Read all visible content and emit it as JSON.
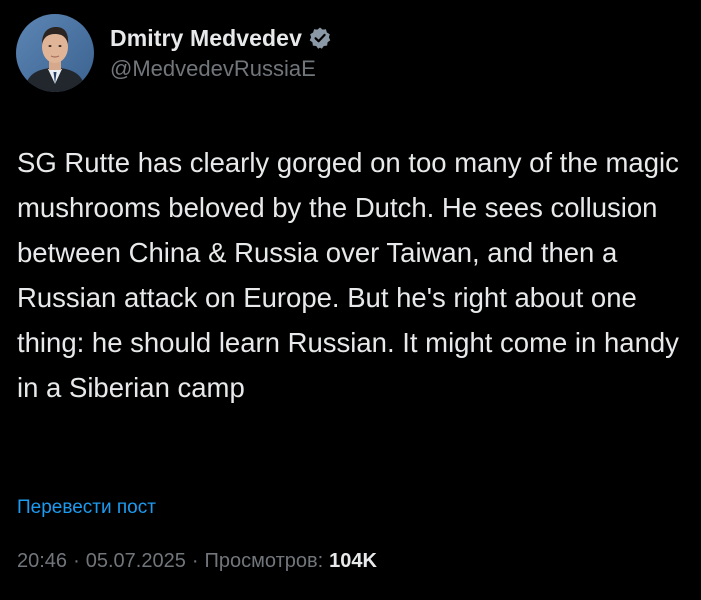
{
  "author": {
    "name": "Dmitry Medvedev",
    "handle": "@MedvedevRussiaE",
    "avatar_icon": "user-avatar",
    "verified_icon": "verified-badge-icon",
    "verified_color": "#8b98a5"
  },
  "post": {
    "text": "SG Rutte has clearly gorged on too many of the magic mushrooms beloved by the Dutch. He sees collusion between China & Russia over Taiwan, and then a Russian attack on Europe. But he's right about one thing: he should learn Russian. It might come in handy in a Siberian camp",
    "translate_label": "Перевести пост"
  },
  "meta": {
    "time": "20:46",
    "separator": "·",
    "date": "05.07.2025",
    "views_label": "Просмотров:",
    "views_count": "104K"
  },
  "colors": {
    "background": "#000000",
    "text": "#e7e9ea",
    "secondary": "#71767b",
    "link": "#1d9bf0"
  }
}
